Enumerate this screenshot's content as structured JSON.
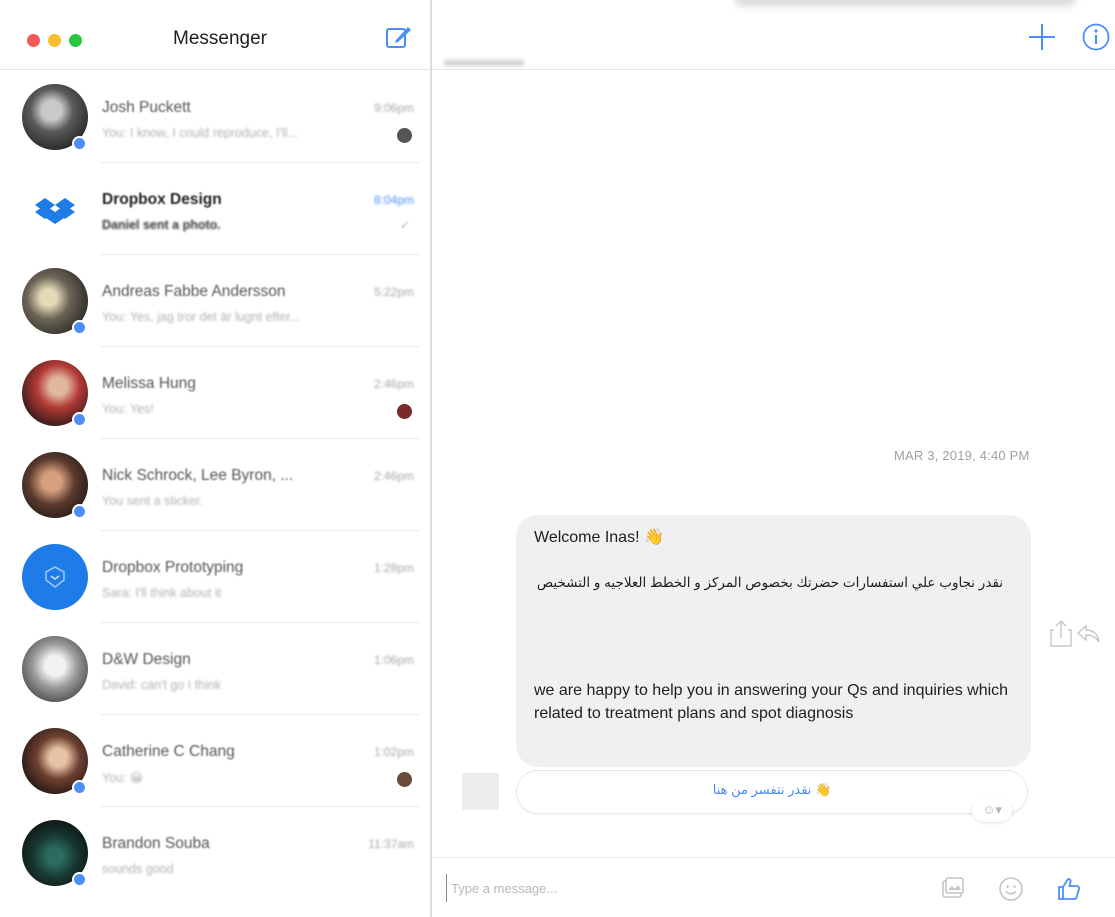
{
  "window": {
    "title": "Messenger"
  },
  "sidebar": {
    "conversations": [
      {
        "name": "Josh Puckett",
        "time": "9:06pm",
        "snippet": "You: I know, I could reproduce, I'll...",
        "unread": false,
        "avatar_color": "#6b6b6b"
      },
      {
        "name": "Dropbox Design",
        "time": "8:04pm",
        "snippet": "Daniel sent a photo.",
        "unread": true,
        "avatar_color": "#1e7ce8"
      },
      {
        "name": "Andreas Fabbe Andersson",
        "time": "5:22pm",
        "snippet": "You: Yes, jag tror det är lugnt efter...",
        "unread": false,
        "avatar_color": "#5d5a50"
      },
      {
        "name": "Melissa Hung",
        "time": "2:46pm",
        "snippet": "You: Yes!",
        "unread": false,
        "avatar_color": "#8a2b2b"
      },
      {
        "name": "Nick Schrock, Lee Byron, ...",
        "time": "2:46pm",
        "snippet": "You sent a sticker.",
        "unread": false,
        "avatar_color": "#4a3b33"
      },
      {
        "name": "Dropbox Prototyping",
        "time": "1:28pm",
        "snippet": "Sara: I'll think about it",
        "unread": false,
        "avatar_color": "#1e7ce8"
      },
      {
        "name": "D&W Design",
        "time": "1:06pm",
        "snippet": "David: can't go I think",
        "unread": false,
        "avatar_color": "#7a7a7a"
      },
      {
        "name": "Catherine C Chang",
        "time": "1:02pm",
        "snippet": "You: 😀",
        "unread": false,
        "avatar_color": "#3a2320"
      },
      {
        "name": "Brandon Souba",
        "time": "11:37am",
        "snippet": "sounds good",
        "unread": false,
        "avatar_color": "#1d3a35"
      }
    ]
  },
  "thread": {
    "timestamp": "MAR 3, 2019, 4:40 PM",
    "message": {
      "welcome": "Welcome Inas! 👋",
      "arabic": "نقدر نجاوب علي استفسارات حضرتك بخصوص المركز و الخطط العلاجيه و التشخيص",
      "english": "we are happy to help you in answering your Qs and inquiries which related to treatment plans and spot diagnosis"
    },
    "quick_reply": "👋 نقدر نتفسر من هنا",
    "react_label": "☺▾"
  },
  "composer": {
    "placeholder": "Type a message..."
  },
  "colors": {
    "accent": "#4c8ffb",
    "bubble": "#f0f0f2"
  }
}
